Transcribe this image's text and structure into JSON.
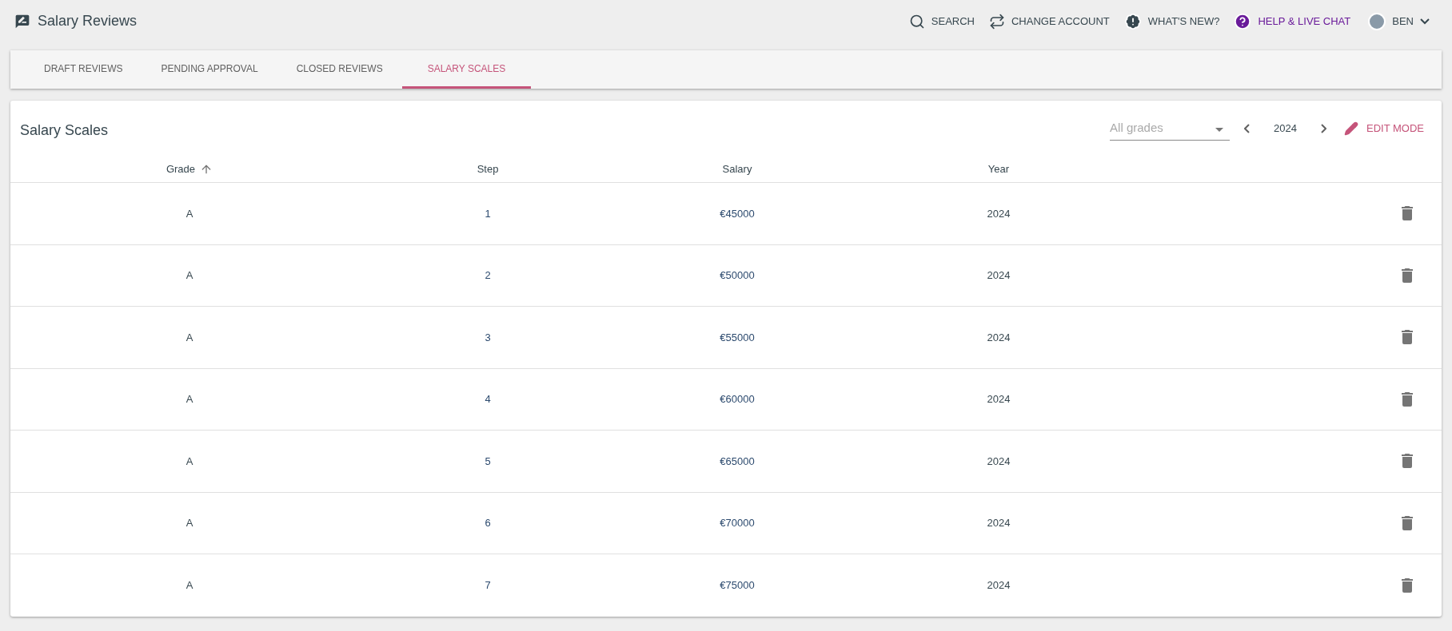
{
  "app": {
    "title": "Salary Reviews"
  },
  "nav": [
    {
      "kind": "search",
      "label": "SEARCH"
    },
    {
      "kind": "switch",
      "label": "CHANGE ACCOUNT"
    },
    {
      "kind": "news",
      "label": "WHAT'S NEW?"
    },
    {
      "kind": "help",
      "label": "HELP & LIVE CHAT"
    }
  ],
  "user": {
    "name": "BEN"
  },
  "tabs": [
    {
      "label": "DRAFT REVIEWS",
      "selected": false
    },
    {
      "label": "PENDING APPROVAL",
      "selected": false
    },
    {
      "label": "CLOSED REVIEWS",
      "selected": false
    },
    {
      "label": "SALARY SCALES",
      "selected": true
    }
  ],
  "card": {
    "title": "Salary Scales",
    "filter": {
      "placeholder": "All grades"
    },
    "year": "2024",
    "edit_mode": "EDIT MODE"
  },
  "table": {
    "columns": [
      "Grade",
      "Step",
      "Salary",
      "Year"
    ],
    "rows": [
      [
        "A",
        "1",
        "€45000",
        "2024"
      ],
      [
        "A",
        "2",
        "€50000",
        "2024"
      ],
      [
        "A",
        "3",
        "€55000",
        "2024"
      ],
      [
        "A",
        "4",
        "€60000",
        "2024"
      ],
      [
        "A",
        "5",
        "€65000",
        "2024"
      ],
      [
        "A",
        "6",
        "€70000",
        "2024"
      ],
      [
        "A",
        "7",
        "€75000",
        "2024"
      ]
    ]
  }
}
